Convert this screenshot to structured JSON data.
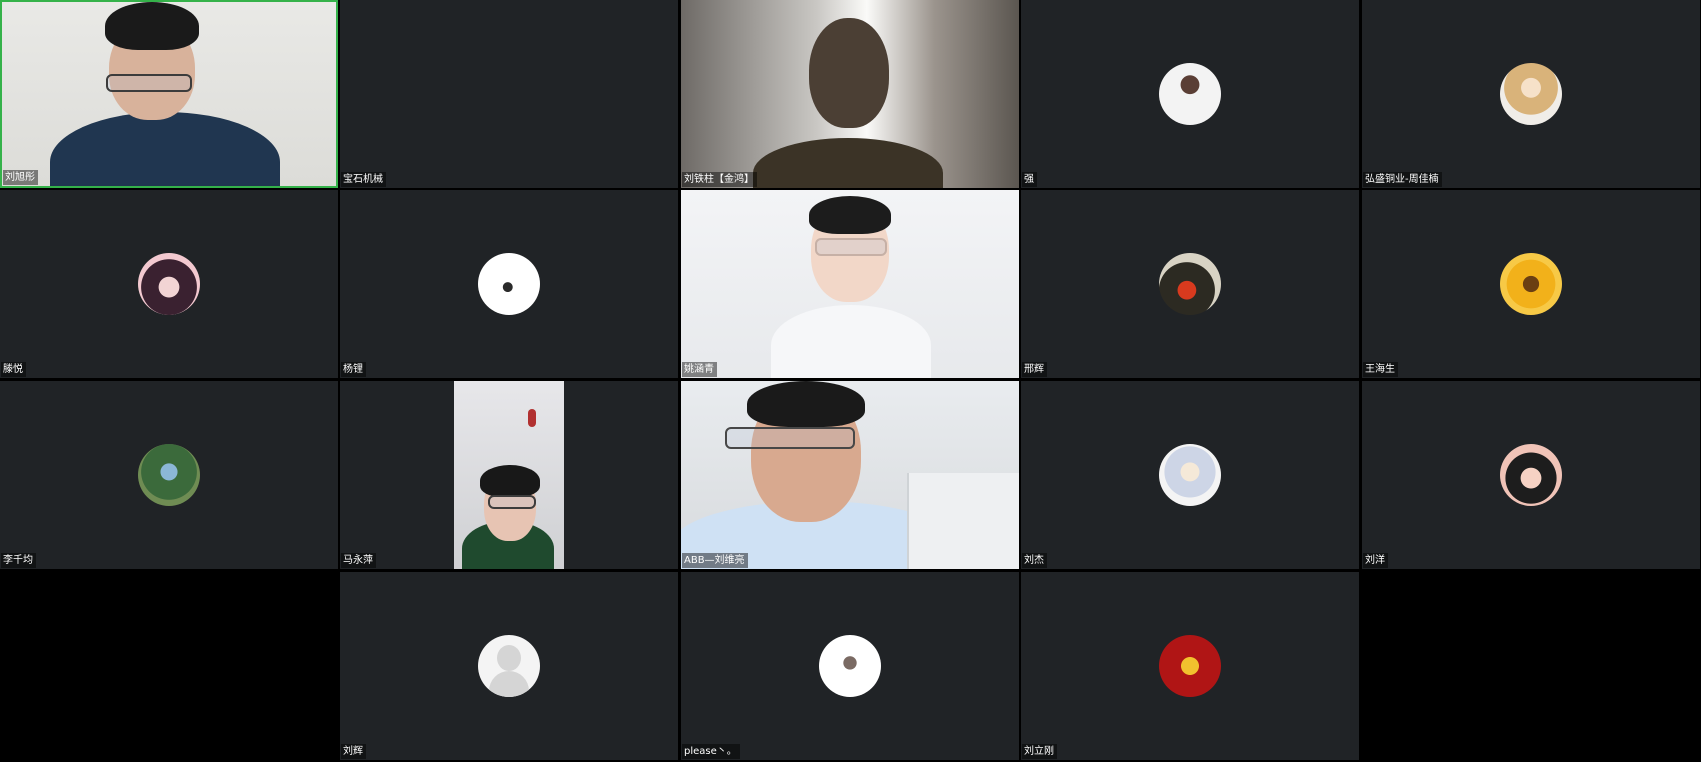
{
  "participants": [
    {
      "name": "刘旭彤",
      "type": "video",
      "avatar": "video-person-icon",
      "active": true
    },
    {
      "name": "宝石机械",
      "type": "blank"
    },
    {
      "name": "刘铁柱【金鸿】",
      "type": "video",
      "avatar": "video-person-icon"
    },
    {
      "name": "强",
      "type": "avatar",
      "avatar": "snow-temple-avatar"
    },
    {
      "name": "弘盛铜业-周佳楠",
      "type": "avatar",
      "avatar": "blonde-portrait-avatar"
    },
    {
      "name": "滕悦",
      "type": "avatar",
      "avatar": "anime-girl-avatar"
    },
    {
      "name": "杨锂",
      "type": "avatar",
      "avatar": "butterfly-avatar"
    },
    {
      "name": "姚涵青",
      "type": "video",
      "avatar": "video-person-icon"
    },
    {
      "name": "邢辉",
      "type": "avatar",
      "avatar": "autumn-photo-avatar"
    },
    {
      "name": "王海生",
      "type": "avatar",
      "avatar": "sunflower-avatar"
    },
    {
      "name": "李千均",
      "type": "avatar",
      "avatar": "landscape-avatar"
    },
    {
      "name": "马永萍",
      "type": "video",
      "avatar": "video-person-icon"
    },
    {
      "name": "ABB—刘维亮",
      "type": "video",
      "avatar": "video-person-icon"
    },
    {
      "name": "刘杰",
      "type": "avatar",
      "avatar": "anime-fairy-avatar"
    },
    {
      "name": "刘洋",
      "type": "avatar",
      "avatar": "anime-character-avatar"
    },
    {
      "name": "",
      "type": "empty"
    },
    {
      "name": "刘辉",
      "type": "avatar",
      "avatar": "default-user-avatar"
    },
    {
      "name": "please丶。",
      "type": "avatar",
      "avatar": "sketch-girl-avatar"
    },
    {
      "name": "刘立刚",
      "type": "avatar",
      "avatar": "golden-dragon-avatar"
    },
    {
      "name": "",
      "type": "empty"
    }
  ],
  "colors": {
    "tile_bg": "#202326",
    "active_border": "#35b24a",
    "label_text": "#ffffff",
    "empty_bg": "#000000"
  }
}
